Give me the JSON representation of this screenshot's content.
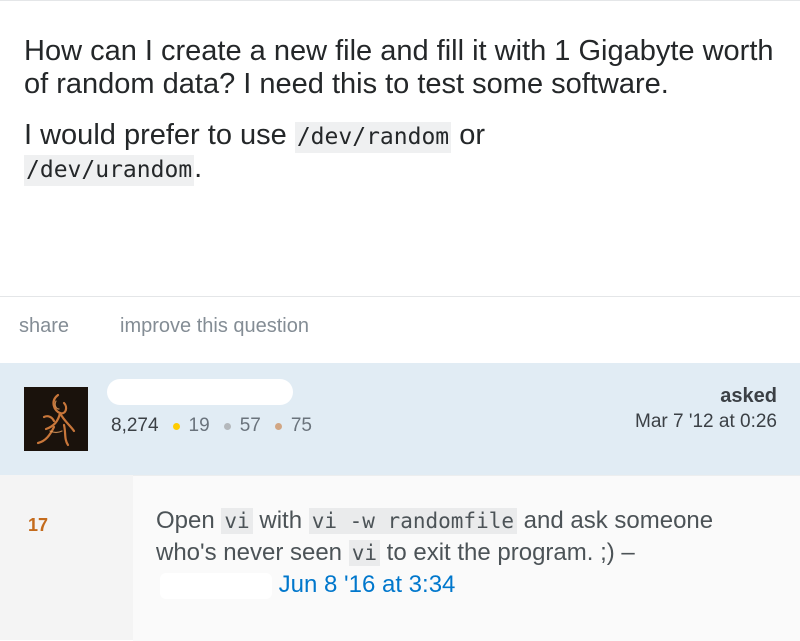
{
  "question": {
    "paragraph1": "How can I create a new file and fill it with 1 Gigabyte worth of random data? I need this to test some software.",
    "paragraph2_before": "I would prefer to use ",
    "code_random": "/dev/random",
    "paragraph2_mid": " or",
    "code_urandom": "/dev/urandom",
    "paragraph2_after": "."
  },
  "actions": {
    "share": "share",
    "improve": "improve this question"
  },
  "owner": {
    "reputation": "8,274",
    "gold": "19",
    "silver": "57",
    "bronze": "75",
    "asked_label": "asked",
    "asked_date": "Mar 7 '12 at 0:26",
    "badge_colors": {
      "gold": "#ffcc01",
      "silver": "#b4b8bc",
      "bronze": "#d1a684"
    }
  },
  "comment": {
    "score": "17",
    "t1": "Open ",
    "code1": "vi",
    "t2": " with ",
    "code2": "vi -w randomfile",
    "t3": " and ask someone who's never seen ",
    "code3": "vi",
    "t4": " to exit the program. ;) – ",
    "date": "Jun 8 '16 at 3:34"
  },
  "colors": {
    "owner_bg": "#e1ecf4",
    "link": "#0077cc",
    "score": "#c46b1c"
  }
}
